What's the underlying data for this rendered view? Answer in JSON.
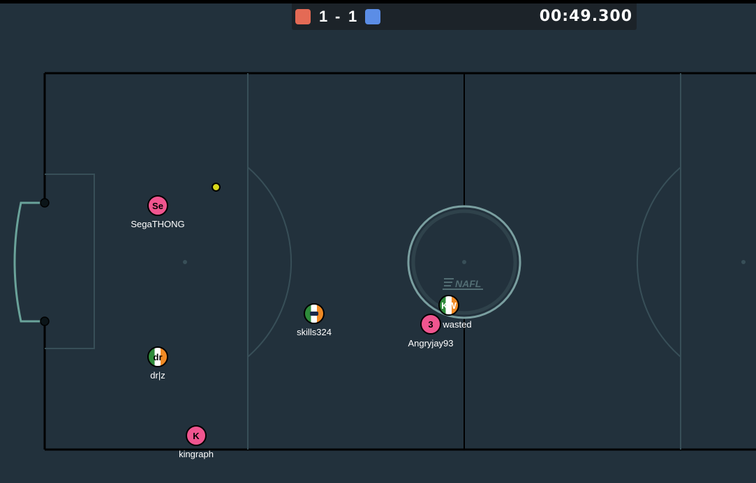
{
  "scoreboard": {
    "red_team_color": "#e46a55",
    "blue_team_color": "#5b8de6",
    "red_score": "1",
    "separator": "-",
    "blue_score": "1",
    "timer": "00:49.300"
  },
  "pitch": {
    "background_color": "#22313c",
    "line_color": "#000000",
    "inner_line_color": "#384f58",
    "goal_color": "#6aa39a",
    "center_logo_text": "NAFL"
  },
  "players": [
    {
      "name": "SegaTHONG",
      "avatar": "Se",
      "team_style": "pink"
    },
    {
      "name": "skills324",
      "avatar": "",
      "team_style": "irish"
    },
    {
      "name": "dr|z",
      "avatar": "dr",
      "team_style": "irish"
    },
    {
      "name": "kingraph",
      "avatar": "K",
      "team_style": "pink"
    },
    {
      "name": "wasted",
      "avatar": "KW",
      "team_style": "irish"
    },
    {
      "name": "Angryjay93",
      "avatar": "3",
      "team_style": "pink"
    }
  ],
  "ball": {
    "color": "#d7d71a"
  }
}
